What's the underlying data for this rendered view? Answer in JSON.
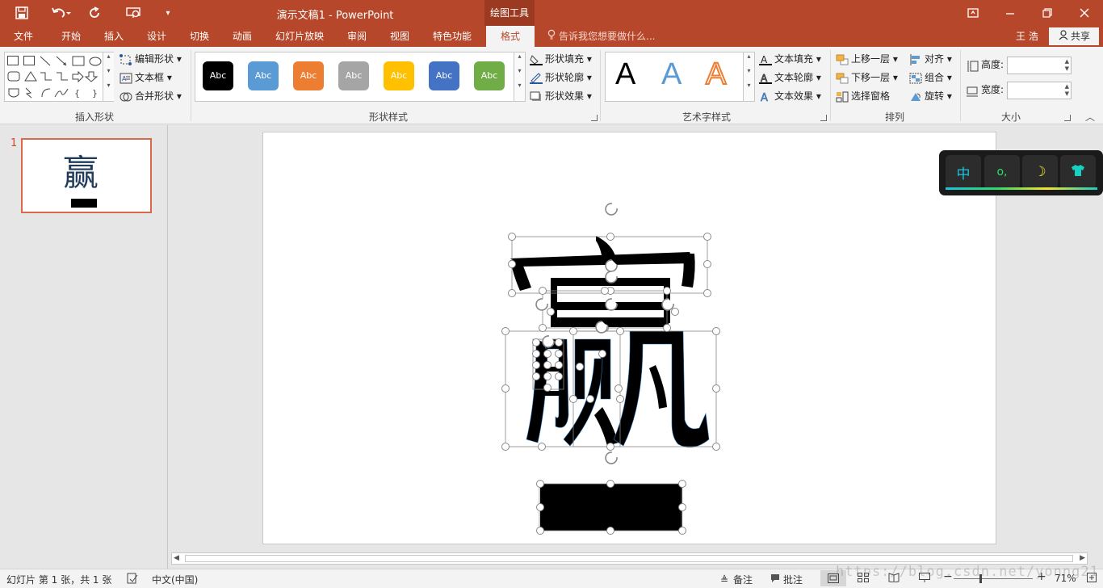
{
  "title_bar": {
    "title": "演示文稿1 - PowerPoint",
    "context_tab": "绘图工具"
  },
  "tabs": [
    "文件",
    "开始",
    "插入",
    "设计",
    "切换",
    "动画",
    "幻灯片放映",
    "审阅",
    "视图",
    "特色功能",
    "格式"
  ],
  "active_tab": "格式",
  "tell_me": "告诉我您想要做什么...",
  "user": "王 浩",
  "share": "共享",
  "ribbon": {
    "insert_shapes": {
      "label": "插入形状",
      "edit_shape": "编辑形状",
      "text_box": "文本框",
      "merge_shapes": "合并形状"
    },
    "shape_styles": {
      "label": "形状样式",
      "swatch_text": "Abc",
      "swatch_colors": [
        "#000000",
        "#5b9bd5",
        "#ed7d31",
        "#a5a5a5",
        "#ffc000",
        "#4472c4",
        "#70ad47"
      ],
      "fill": "形状填充",
      "outline": "形状轮廓",
      "effects": "形状效果"
    },
    "wordart_styles": {
      "label": "艺术字样式",
      "sample": "A",
      "text_fill": "文本填充",
      "text_outline": "文本轮廓",
      "text_effects": "文本效果"
    },
    "arrange": {
      "label": "排列",
      "bring_forward": "上移一层",
      "send_backward": "下移一层",
      "selection_pane": "选择窗格",
      "align": "对齐",
      "group": "组合",
      "rotate": "旋转"
    },
    "size": {
      "label": "大小",
      "height": "高度:",
      "width": "宽度:"
    }
  },
  "thumbnail": {
    "number": "1",
    "glyph": "赢"
  },
  "ime_toolbar": {
    "lang": "中",
    "punct": "o,",
    "moon": "☽",
    "skin": "shirt-icon"
  },
  "status": {
    "slide_info": "幻灯片 第 1 张，共 1 张",
    "language": "中文(中国)",
    "notes": "备注",
    "comments": "批注",
    "zoom_minus": "−",
    "zoom_plus": "+",
    "zoom": "71%"
  },
  "watermark": "https://blog.csdn.net/yonng21",
  "colors": {
    "accent": "#b7472a",
    "active_tab_text": "#b7472a"
  }
}
